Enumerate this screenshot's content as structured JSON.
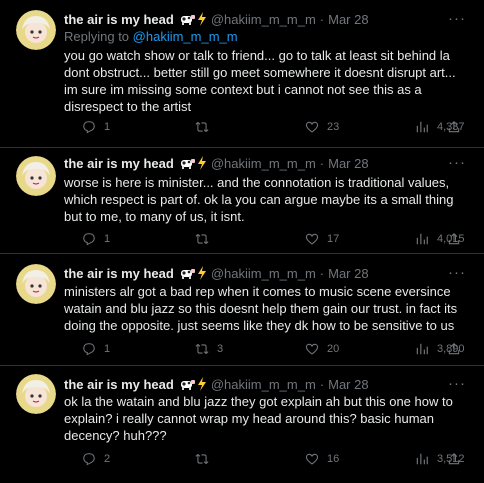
{
  "reply_context": {
    "prefix": "Replying to",
    "handle": "@hakiim_m_m_m"
  },
  "tweets": [
    {
      "name": "the air is my head",
      "handle": "@hakiim_m_m_m",
      "separator": "·",
      "date": "Mar 28",
      "text": "you go watch show or talk to friend... go to talk at least sit behind la dont obstruct... better still go meet somewhere it doesnt disrupt art... im sure im missing some context but i cannot not see this as a disrespect to the artist",
      "replies": "1",
      "retweets": "",
      "likes": "23",
      "views": "4,337"
    },
    {
      "name": "the air is my head",
      "handle": "@hakiim_m_m_m",
      "separator": "·",
      "date": "Mar 28",
      "text": "worse is here is minister... and the connotation is traditional values, which respect is part of. ok la you can argue maybe its a small thing but to me, to many of us, it isnt.",
      "replies": "1",
      "retweets": "",
      "likes": "17",
      "views": "4,015"
    },
    {
      "name": "the air is my head",
      "handle": "@hakiim_m_m_m",
      "separator": "·",
      "date": "Mar 28",
      "text": "ministers alr got a bad rep when it comes to music scene eversince watain and blu jazz so this doesnt help them gain our trust. in fact its doing the opposite. just seems like they dk how to be sensitive to us",
      "replies": "1",
      "retweets": "3",
      "likes": "20",
      "views": "3,890"
    },
    {
      "name": "the air is my head",
      "handle": "@hakiim_m_m_m",
      "separator": "·",
      "date": "Mar 28",
      "text": "ok la the watain and blu jazz they got explain ah but this one how to explain? i really cannot wrap my head around this? basic human decency? huh???",
      "replies": "2",
      "retweets": "",
      "likes": "16",
      "views": "3,512"
    }
  ],
  "colors": {
    "background": "#000000",
    "text": "#e7e9ea",
    "muted": "#71767b",
    "link": "#1d9bf0",
    "divider": "#2f3336"
  },
  "icons": [
    "avatar",
    "cow-emoji",
    "lightning-emoji",
    "more-icon",
    "reply-icon",
    "retweet-icon",
    "like-icon",
    "views-icon",
    "share-icon"
  ]
}
